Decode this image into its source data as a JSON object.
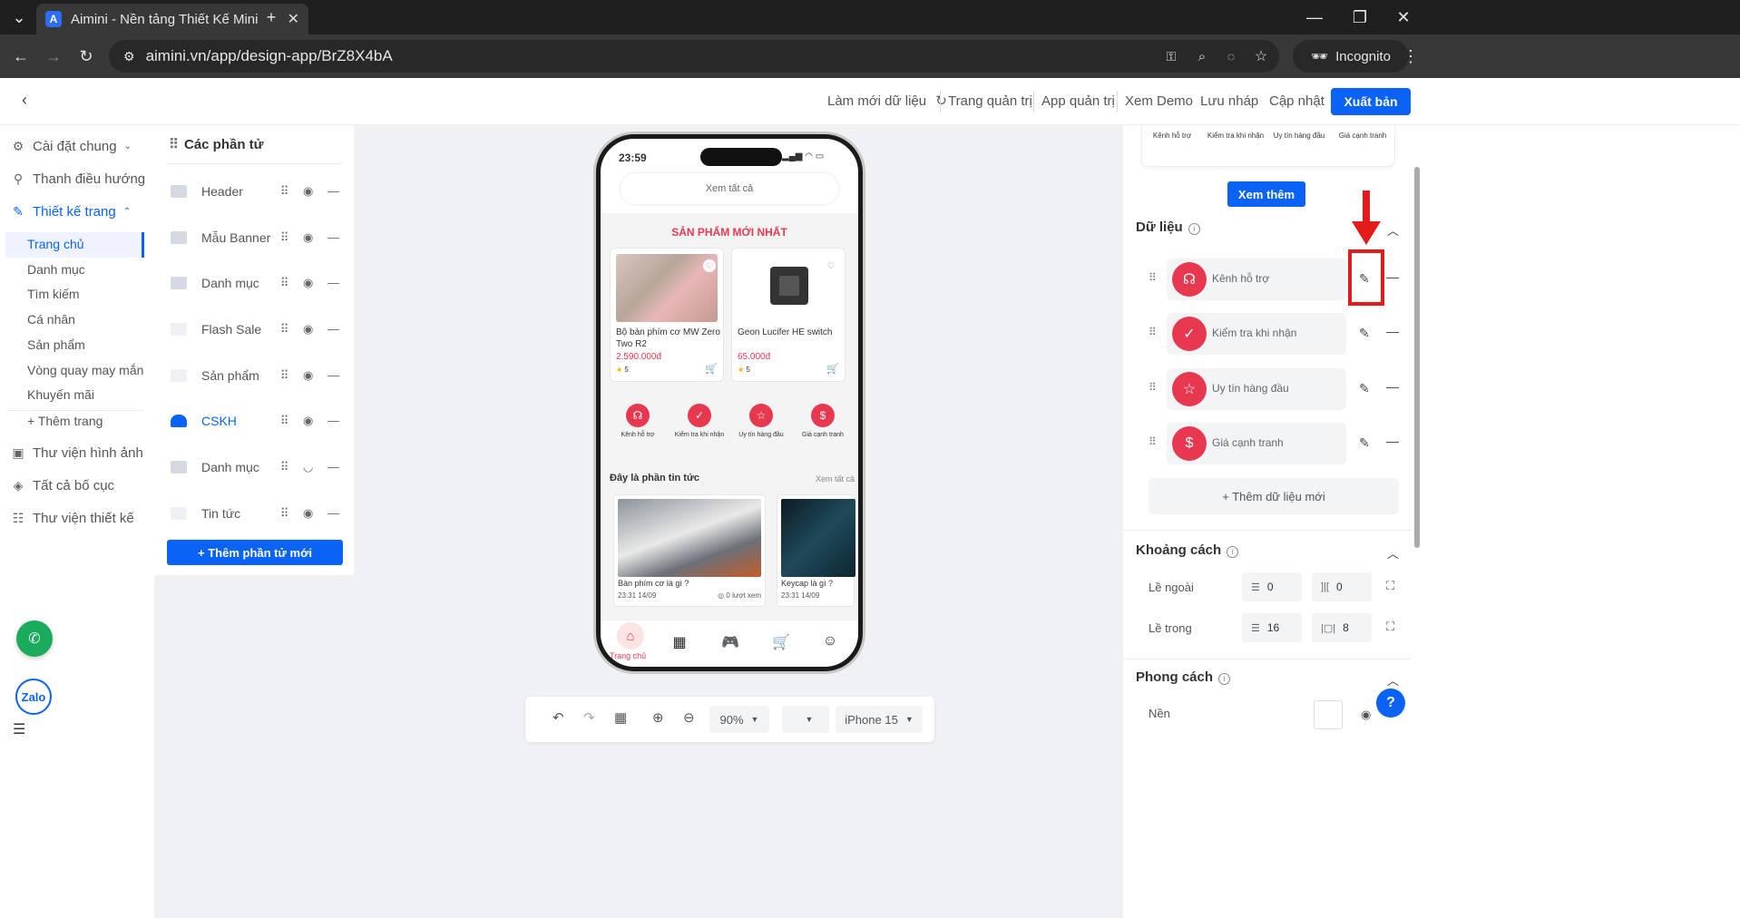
{
  "browser": {
    "tab_title": "Aimini - Nền tảng Thiết Kế Mini",
    "tab_favicon_letter": "A",
    "url": "aimini.vn/app/design-app/BrZ8X4bA",
    "incognito_label": "Incognito"
  },
  "header": {
    "refresh_data": "Làm mới dữ liệu",
    "admin_page": "Trang quản trị",
    "admin_app": "App quản trị",
    "demo": "Xem Demo",
    "save_draft": "Lưu nháp",
    "update": "Cập nhật",
    "publish": "Xuất bản"
  },
  "leftnav": {
    "general_settings": "Cài đặt chung",
    "nav_bar": "Thanh điều hướng",
    "page_design": "Thiết kế trang",
    "pages": [
      "Trang chủ",
      "Danh mục",
      "Tìm kiếm",
      "Cá nhân",
      "Sản phẩm",
      "Vòng quay may mắn",
      "Khuyến mãi"
    ],
    "add_page": "+ Thêm trang",
    "image_library": "Thư viện hình ảnh",
    "all_layouts": "Tất cả bố cục",
    "design_library": "Thư viện thiết kế"
  },
  "elements": {
    "title": "Các phần tử",
    "items": [
      "Header",
      "Mẫu Banner",
      "Danh mục",
      "Flash Sale",
      "Sản phẩm",
      "CSKH",
      "Danh mục",
      "Tin tức"
    ],
    "add_button": "+ Thêm phần tử mới"
  },
  "phone": {
    "time": "23:59",
    "see_all": "Xem tất cả",
    "section_title": "SẢN PHẨM MỚI NHẤT",
    "products": [
      {
        "name": "Bộ bàn phím cơ MW Zero Two R2",
        "price": "2.590.000đ",
        "rating": "5"
      },
      {
        "name": "Geon Lucifer HE switch",
        "price": "65.000đ",
        "rating": "5"
      }
    ],
    "services": [
      "Kênh hỗ trợ",
      "Kiểm tra khi nhận",
      "Uy tín hàng đầu",
      "Giá cạnh tranh"
    ],
    "news_title": "Đây là phần tin tức",
    "news_see_all": "Xem tất cả",
    "news": [
      {
        "title": "Bàn phím cơ là gì ?",
        "date": "23:31 14/09",
        "views": "0 lượt xem"
      },
      {
        "title": "Keycap là gì ?",
        "date": "23:31 14/09"
      }
    ],
    "home_label": "Trang chủ"
  },
  "toolbar": {
    "zoom": "90%",
    "device": "iPhone 15"
  },
  "rightpanel": {
    "strip_services": [
      "Kênh hỗ trợ",
      "Kiểm tra khi nhận",
      "Uy tín hàng đầu",
      "Giá cạnh tranh"
    ],
    "see_more": "Xem thêm",
    "data_title": "Dữ liệu",
    "data_items": [
      "Kênh hỗ trợ",
      "Kiểm tra khi nhận",
      "Uy tín hàng đầu",
      "Giá cạnh tranh"
    ],
    "add_data": "+ Thêm dữ liệu mới",
    "spacing_title": "Khoảng cách",
    "margin_label": "Lề ngoài",
    "margin_v": "0",
    "margin_h": "0",
    "padding_label": "Lề trong",
    "padding_v": "16",
    "padding_h": "8",
    "style_title": "Phong cách",
    "background_label": "Nền"
  },
  "floating": {
    "zalo": "Zalo",
    "help": "?"
  },
  "colors": {
    "accent": "#0a63f5",
    "brand_red": "#e8384f",
    "highlight": "#e31b1b"
  }
}
